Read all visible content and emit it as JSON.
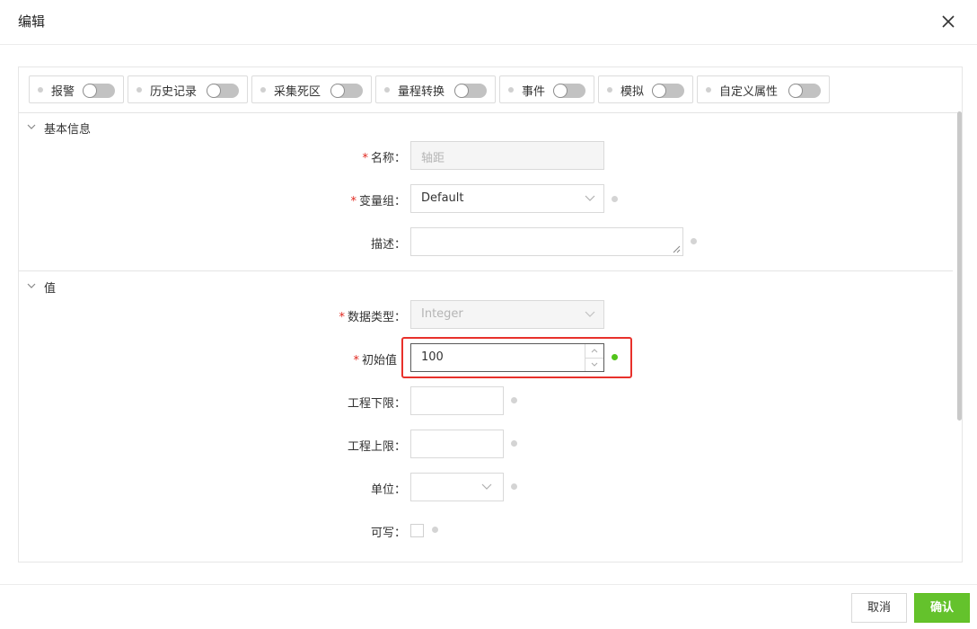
{
  "dialog": {
    "title": "编辑"
  },
  "feature_toggles": [
    {
      "label": "报警",
      "enabled": false
    },
    {
      "label": "历史记录",
      "enabled": false
    },
    {
      "label": "采集死区",
      "enabled": false
    },
    {
      "label": "量程转换",
      "enabled": false
    },
    {
      "label": "事件",
      "enabled": false
    },
    {
      "label": "模拟",
      "enabled": false
    },
    {
      "label": "自定义属性",
      "enabled": false
    }
  ],
  "sections": {
    "basic": {
      "title": "基本信息",
      "expanded": true
    },
    "value": {
      "title": "值",
      "expanded": true
    }
  },
  "form": {
    "required_mark": "*",
    "name": {
      "label": "名称：",
      "value": "轴距",
      "disabled": true
    },
    "variable_group": {
      "label": "变量组：",
      "value": "Default"
    },
    "description": {
      "label": "描述：",
      "value": ""
    },
    "data_type": {
      "label": "数据类型：",
      "value": "Integer",
      "disabled": true
    },
    "initial_value": {
      "label": "初始值",
      "value": "100"
    },
    "eng_low": {
      "label": "工程下限：",
      "value": ""
    },
    "eng_high": {
      "label": "工程上限：",
      "value": ""
    },
    "unit": {
      "label": "单位：",
      "value": ""
    },
    "writable": {
      "label": "可写：",
      "checked": false
    }
  },
  "buttons": {
    "cancel": "取消",
    "confirm": "确认"
  },
  "colors": {
    "accent": "#64c22c",
    "required": "#e0281f",
    "highlight": "#e8312b",
    "status_ok": "#52c41a"
  }
}
